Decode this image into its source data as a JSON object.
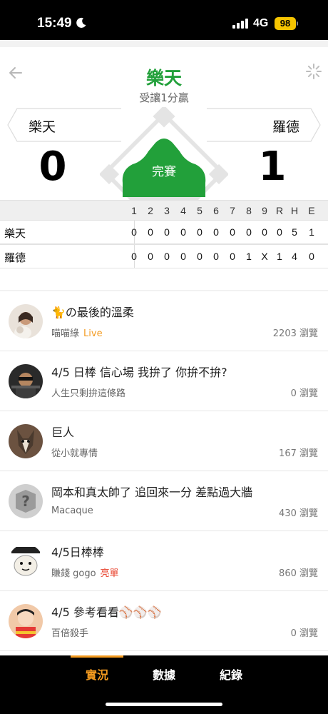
{
  "status_bar": {
    "time": "15:49",
    "network": "4G",
    "battery": "98"
  },
  "game": {
    "title": "樂天",
    "subtitle": "受讓1分贏",
    "state": "完賽",
    "away": {
      "name": "樂天",
      "score": "0"
    },
    "home": {
      "name": "羅德",
      "score": "1"
    }
  },
  "linescore": {
    "headers": [
      "1",
      "2",
      "3",
      "4",
      "5",
      "6",
      "7",
      "8",
      "9",
      "R",
      "H",
      "E"
    ],
    "rows": [
      {
        "team": "樂天",
        "cells": [
          "0",
          "0",
          "0",
          "0",
          "0",
          "0",
          "0",
          "0",
          "0",
          "0",
          "5",
          "1"
        ]
      },
      {
        "team": "羅德",
        "cells": [
          "0",
          "0",
          "0",
          "0",
          "0",
          "0",
          "0",
          "1",
          "X",
          "1",
          "4",
          "0"
        ]
      }
    ]
  },
  "posts": [
    {
      "title": "🐈の最後的溫柔",
      "author": "喵喵綠",
      "tag": "Live",
      "tag_color": "#f39a1f",
      "views": "2203 瀏覽"
    },
    {
      "title": "4/5 日棒 信心場 我拚了 你拚不拚?",
      "author": "人生只剩拚這條路",
      "tag": "",
      "tag_color": "",
      "views": "0 瀏覽"
    },
    {
      "title": "巨人",
      "author": "從小就專情",
      "tag": "",
      "tag_color": "",
      "views": "167 瀏覽"
    },
    {
      "title": "岡本和真太帥了 追回來一分 差點過大牆",
      "author": "Macaque",
      "tag": "",
      "tag_color": "",
      "views": "430 瀏覽"
    },
    {
      "title": "4/5日棒棒",
      "author": "賺錢 gogo",
      "tag": "亮單",
      "tag_color": "#e8412c",
      "views": "860 瀏覽"
    },
    {
      "title": "4/5 參考看看⚾⚾⚾",
      "author": "百倍殺手",
      "tag": "",
      "tag_color": "",
      "views": "0 瀏覽"
    }
  ],
  "tabs": [
    {
      "label": "實況",
      "active": true
    },
    {
      "label": "數據",
      "active": false
    },
    {
      "label": "紀錄",
      "active": false
    }
  ],
  "colors": {
    "accent": "#22a03a",
    "tab_active": "#f39a1f"
  }
}
